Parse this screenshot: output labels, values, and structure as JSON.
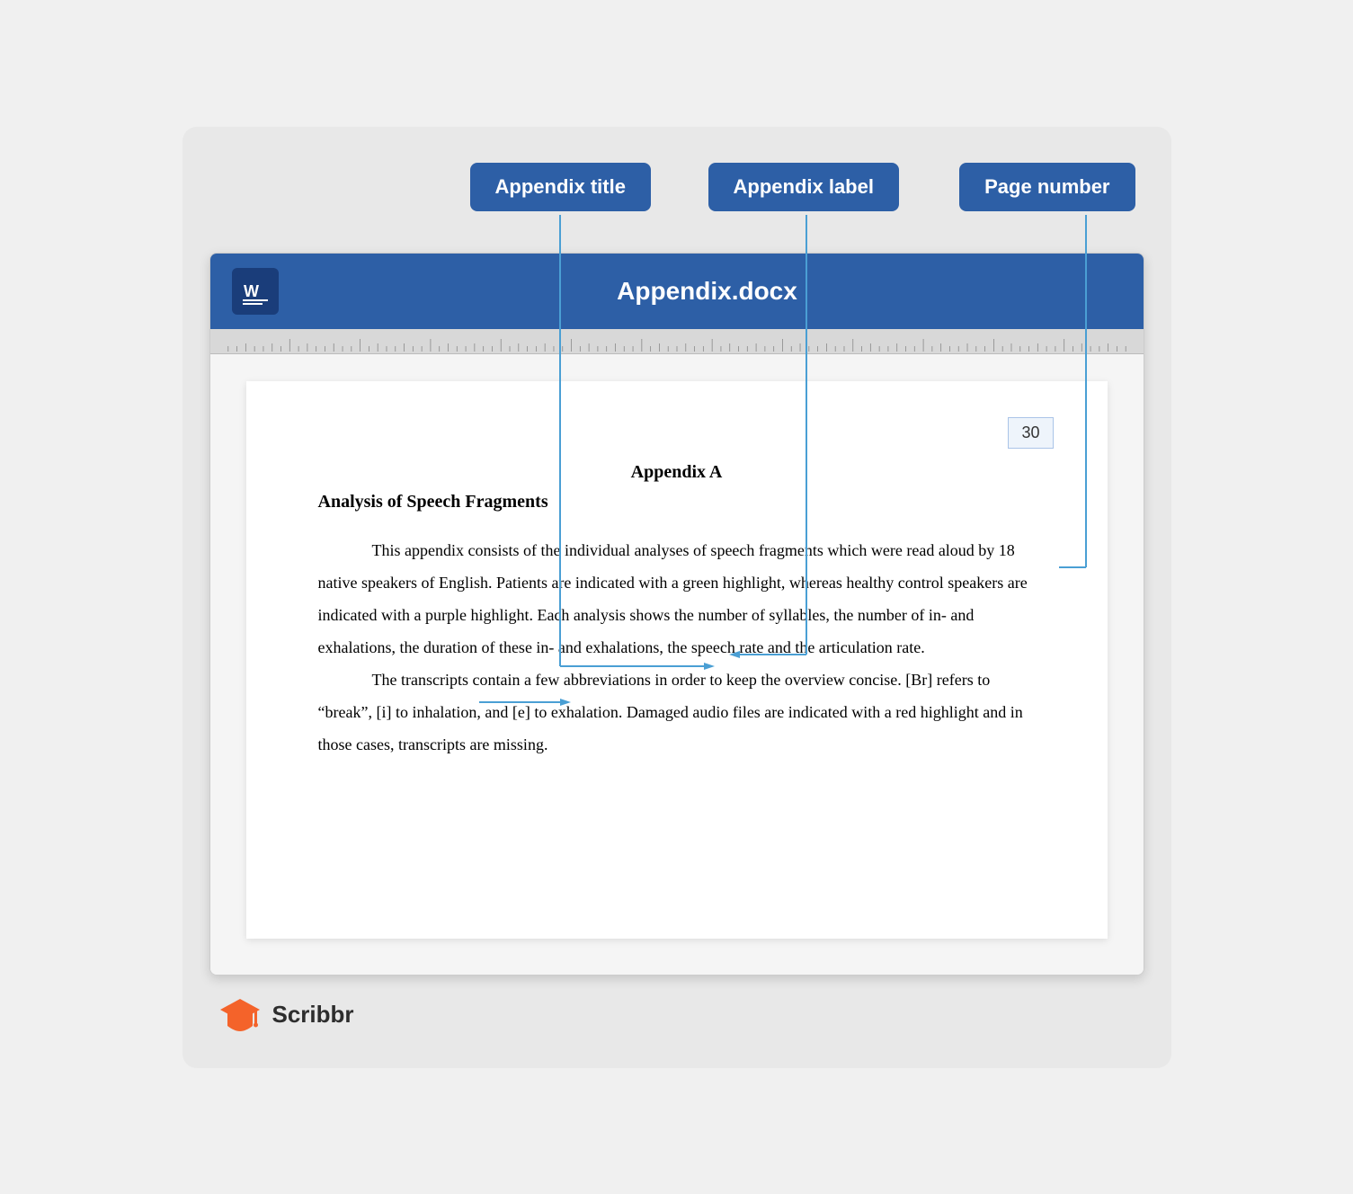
{
  "labels": {
    "appendix_title": "Appendix title",
    "appendix_label": "Appendix label",
    "page_number": "Page number"
  },
  "titlebar": {
    "filename": "Appendix.docx",
    "word_label": "W≡"
  },
  "page": {
    "page_num": "30",
    "appendix_label": "Appendix A",
    "analysis_heading": "Analysis of Speech Fragments",
    "paragraph1": "This appendix consists of the individual analyses of speech fragments which were read aloud by 18 native speakers of English. Patients are indicated with a green highlight, whereas healthy control speakers are indicated with a purple highlight. Each analysis shows the number of syllables, the number of in- and exhalations, the duration of these in- and exhalations, the speech rate and the articulation rate.",
    "paragraph2": "The transcripts contain a few abbreviations in order to keep the overview concise. [Br] refers to “break”, [i] to inhalation, and [e] to exhalation. Damaged audio files are indicated with a red highlight and in those cases, transcripts are missing."
  },
  "footer": {
    "brand": "Scribbr"
  },
  "colors": {
    "badge_bg": "#2d5fa6",
    "badge_text": "#ffffff",
    "titlebar_bg": "#2d5fa6",
    "annotation_line": "#4a9fd4",
    "page_num_border": "#aac4e8",
    "page_num_bg": "#eef4fb"
  }
}
